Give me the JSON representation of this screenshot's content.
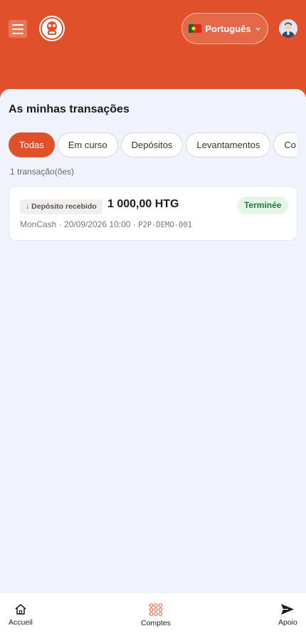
{
  "header": {
    "language": {
      "flag": "pt",
      "label": "Português"
    },
    "accent_color": "#e0512b"
  },
  "page": {
    "title": "As minhas transações",
    "count_text": "1 transação(ões)"
  },
  "tabs": [
    {
      "label": "Todas",
      "active": true
    },
    {
      "label": "Em curso",
      "active": false
    },
    {
      "label": "Depósitos",
      "active": false
    },
    {
      "label": "Levantamentos",
      "active": false
    },
    {
      "label": "Co",
      "active": false
    }
  ],
  "transactions": [
    {
      "type_label": "↓ Depósito recebido",
      "amount": "1 000,00 HTG",
      "status": "Terminée",
      "status_color": "#1f7a3a",
      "meta": "MonCash · 20/09/2026 10:00 ·",
      "reference": "P2P-DEMO-001"
    }
  ],
  "bottom_nav": [
    {
      "label": "Accueil",
      "icon": "home-icon"
    },
    {
      "label": "Comptes",
      "icon": "grid-dots-icon"
    },
    {
      "label": "Apoio",
      "icon": "send-icon"
    }
  ]
}
